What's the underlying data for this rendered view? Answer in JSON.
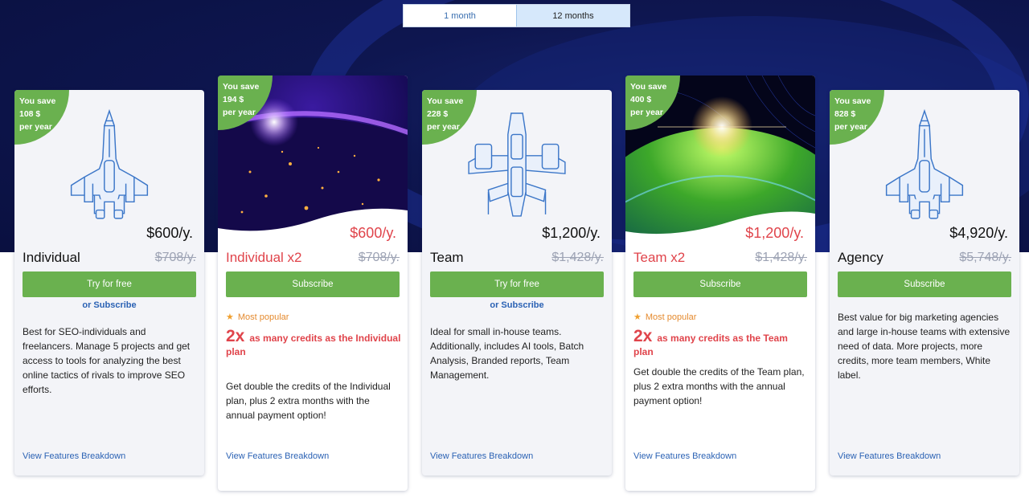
{
  "billing_toggle": {
    "month_label": "1 month",
    "year_label": "12 months"
  },
  "plans": [
    {
      "save_lines": [
        "You save",
        "108 $",
        "per year"
      ],
      "price": "$600/y.",
      "name": "Individual",
      "old_price": "$708/y.",
      "button": "Try for free",
      "or_subscribe": "or Subscribe",
      "description": "Best for SEO-individuals and freelancers. Manage 5 projects and get access to tools for analyzing the best online tactics of rivals to improve SEO efforts.",
      "features_link": "View Features Breakdown"
    },
    {
      "save_lines": [
        "You save",
        "194 $",
        "per year"
      ],
      "price": "$600/y.",
      "name": "Individual x2",
      "old_price": "$708/y.",
      "button": "Subscribe",
      "popular": "Most popular",
      "multiplier": "2x",
      "credits_text": "as many credits as the Individual plan",
      "description": "Get double the credits of the Individual plan, plus 2 extra months with the annual payment option!",
      "features_link": "View Features Breakdown"
    },
    {
      "save_lines": [
        "You save",
        "228 $",
        "per year"
      ],
      "price": "$1,200/y.",
      "name": "Team",
      "old_price": "$1,428/y.",
      "button": "Try for free",
      "or_subscribe": "or Subscribe",
      "description": "Ideal for small in-house teams. Additionally, includes AI tools, Batch Analysis, Branded reports, Team Management.",
      "features_link": "View Features Breakdown"
    },
    {
      "save_lines": [
        "You save",
        "400 $",
        "per year"
      ],
      "price": "$1,200/y.",
      "name": "Team x2",
      "old_price": "$1,428/y.",
      "button": "Subscribe",
      "popular": "Most popular",
      "multiplier": "2x",
      "credits_text": "as many credits as the Team plan",
      "description": "Get double the credits of the Team plan, plus 2 extra months with the annual payment option!",
      "features_link": "View Features Breakdown"
    },
    {
      "save_lines": [
        "You save",
        "828 $",
        "per year"
      ],
      "price": "$4,920/y.",
      "name": "Agency",
      "old_price": "$5,748/y.",
      "button": "Subscribe",
      "description": "Best value for big marketing agencies and large in-house teams with extensive need of data. More projects, more credits, more team members, White label.",
      "features_link": "View Features Breakdown"
    }
  ],
  "colors": {
    "accent_green": "#6ab14f",
    "popular_red": "#e0444b",
    "link_blue": "#2b62b4",
    "hero_navy": "#0e1650"
  },
  "icons": {
    "ship": "spaceship-icon",
    "star": "star-icon"
  }
}
